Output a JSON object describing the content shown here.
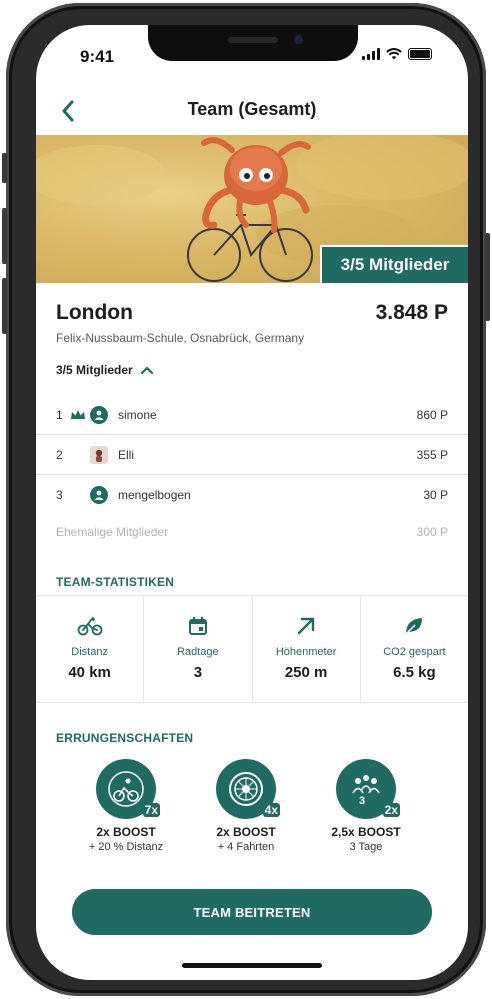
{
  "status": {
    "time": "9:41"
  },
  "nav": {
    "title": "Team (Gesamt)"
  },
  "hero": {
    "members_pill": "3/5 Mitglieder"
  },
  "team": {
    "name": "London",
    "points": "3.848 P",
    "school": "Felix-Nussbaum-Schule, Osnabrück, Germany"
  },
  "members": {
    "toggle_label": "3/5 Mitglieder",
    "list": [
      {
        "rank": "1",
        "name": "simone",
        "points": "860 P",
        "leader": true
      },
      {
        "rank": "2",
        "name": "Elli",
        "points": "355 P",
        "leader": false
      },
      {
        "rank": "3",
        "name": "mengelbogen",
        "points": "30 P",
        "leader": false
      }
    ],
    "former": {
      "label": "Ehemalige Mitglieder",
      "points": "300 P"
    }
  },
  "stats": {
    "title": "TEAM-STATISTIKEN",
    "items": [
      {
        "icon": "bike-icon",
        "label": "Distanz",
        "value": "40 km"
      },
      {
        "icon": "calendar-icon",
        "label": "Radtage",
        "value": "3"
      },
      {
        "icon": "arrow-up-right-icon",
        "label": "Höhenmeter",
        "value": "250 m"
      },
      {
        "icon": "leaf-icon",
        "label": "CO2 gespart",
        "value": "6.5 kg"
      }
    ]
  },
  "achievements": {
    "title": "ERRUNGENSCHAFTEN",
    "items": [
      {
        "icon": "cyclist-badge-icon",
        "multiplier": "7x",
        "boost": "2x BOOST",
        "desc": "+ 20 % Distanz"
      },
      {
        "icon": "wheel-badge-icon",
        "multiplier": "4x",
        "boost": "2x BOOST",
        "desc": "+ 4 Fahrten"
      },
      {
        "icon": "group-badge-icon",
        "multiplier": "2x",
        "boost": "2,5x BOOST",
        "desc": "3 Tage"
      }
    ]
  },
  "cta": {
    "label": "TEAM BEITRETEN"
  },
  "colors": {
    "accent": "#1f6b64",
    "hero_bg": "#d9b866"
  }
}
